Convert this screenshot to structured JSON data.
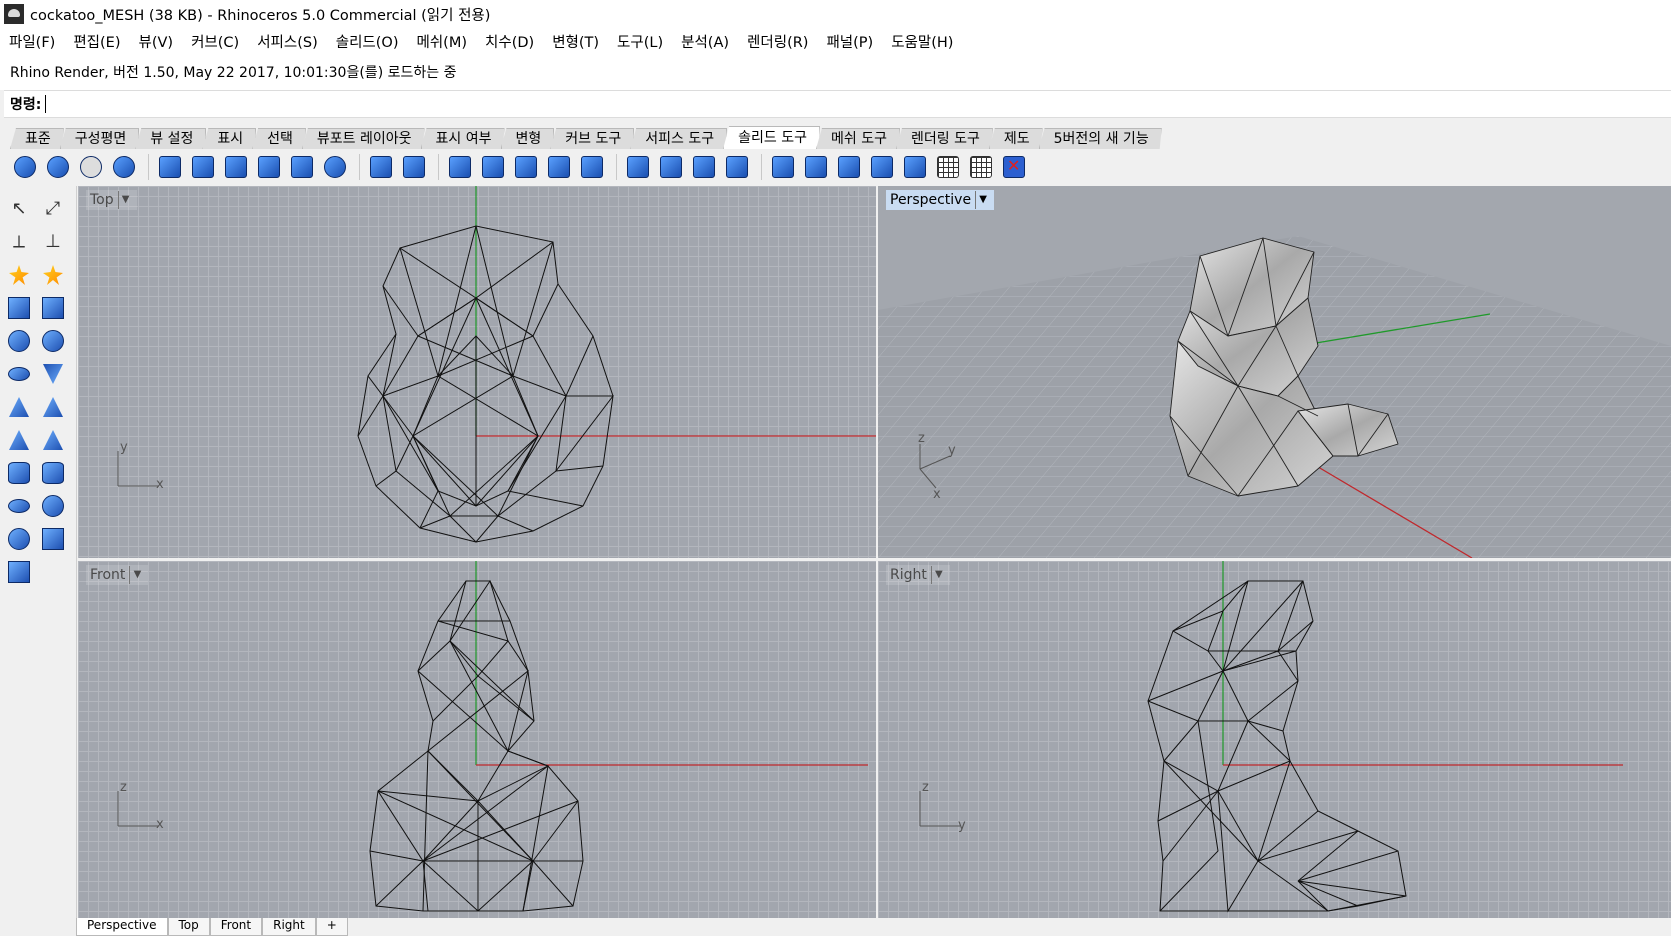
{
  "window": {
    "title": "cockatoo_MESH (38 KB) - Rhinoceros 5.0 Commercial (읽기 전용)"
  },
  "menu": [
    "파일(F)",
    "편집(E)",
    "뷰(V)",
    "커브(C)",
    "서피스(S)",
    "솔리드(O)",
    "메쉬(M)",
    "치수(D)",
    "변형(T)",
    "도구(L)",
    "분석(A)",
    "렌더링(R)",
    "패널(P)",
    "도움말(H)"
  ],
  "status": {
    "message": "Rhino Render, 버전 1.50, May 22 2017, 10:01:30을(를) 로드하는 중"
  },
  "command": {
    "label": "명령:",
    "value": ""
  },
  "tabs": [
    "표준",
    "구성평면",
    "뷰 설정",
    "표시",
    "선택",
    "뷰포트 레이아웃",
    "표시 여부",
    "변형",
    "커브 도구",
    "서피스 도구",
    "솔리드 도구",
    "메쉬 도구",
    "렌더링 도구",
    "제도",
    "5버전의 새 기능"
  ],
  "active_tab": "솔리드 도구",
  "toolbar_icons": [
    "boolean-union-icon",
    "boolean-difference-icon",
    "boolean-intersection-icon",
    "boolean-split-icon",
    "extrude-face-icon",
    "cap-holes-icon",
    "shell-icon",
    "slab-icon",
    "box-icon",
    "fillet-edges-icon",
    "solid-edit-icon",
    "solid-edit-2-icon",
    "move-face-icon",
    "extrude-edge-icon",
    "move-edge-icon",
    "split-face-icon",
    "merge-face-icon",
    "move-hole-icon",
    "rotate-hole-icon",
    "move-untrimmed-icon",
    "wire-cut-icon",
    "object-ops-icon",
    "unroll-icon",
    "section-icon",
    "curve-boolean-icon",
    "mesh-grid-icon",
    "mesh-grid-2-icon",
    "delete-icon"
  ],
  "sidebar_icons": [
    "select-icon",
    "point-icon",
    "polyline-icon",
    "curve-icon",
    "gear-icon",
    "lightning-icon",
    "box-icon",
    "box-edit-icon",
    "sphere-icon",
    "sphere-edit-icon",
    "ellipsoid-icon",
    "paraboloid-icon",
    "cone-icon",
    "truncated-cone-icon",
    "pyramid-icon",
    "truncated-pyramid-icon",
    "cylinder-icon",
    "tube-icon",
    "torus-icon",
    "pipe-icon",
    "revolve-icon",
    "extrude-icon",
    "plane-icon"
  ],
  "viewports": {
    "top": {
      "label": "Top",
      "axis_a": "y",
      "axis_b": "x"
    },
    "perspective": {
      "label": "Perspective",
      "axis_a": "z",
      "axis_b": "y",
      "axis_c": "x"
    },
    "front": {
      "label": "Front",
      "axis_a": "z",
      "axis_b": "x"
    },
    "right": {
      "label": "Right",
      "axis_a": "z",
      "axis_b": "y"
    }
  },
  "bottom_tabs": [
    "Perspective",
    "Top",
    "Front",
    "Right",
    "+"
  ],
  "colors": {
    "x_axis": "#c0282c",
    "y_axis": "#1f9a2a",
    "viewport_bg": "#a2a6ae",
    "grid": "#b3b6bd",
    "wire": "#111111"
  }
}
